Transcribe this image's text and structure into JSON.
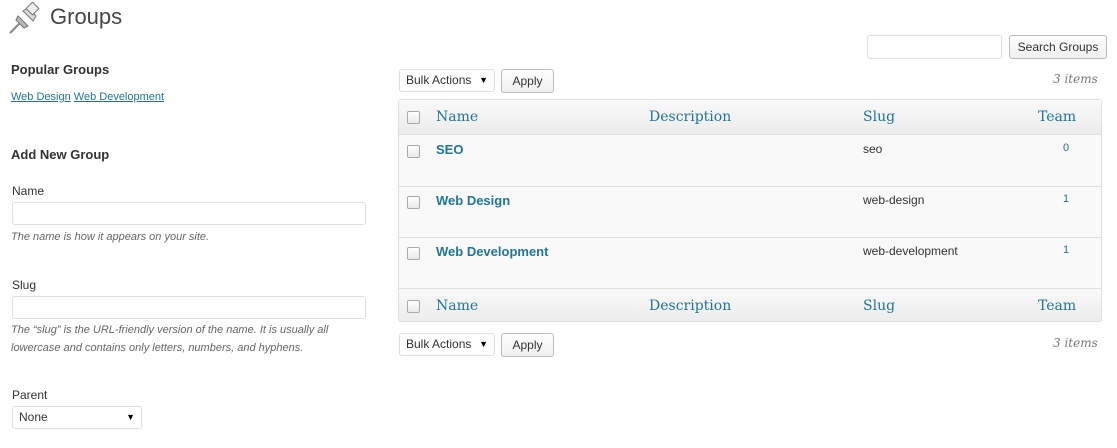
{
  "header": {
    "title": "Groups",
    "icon": "pushpin-icon"
  },
  "popular": {
    "title": "Popular Groups",
    "links": [
      "Web Design",
      "Web Development"
    ]
  },
  "add_group": {
    "title": "Add New Group",
    "name_label": "Name",
    "name_value": "",
    "name_hint": "The name is how it appears on your site.",
    "slug_label": "Slug",
    "slug_value": "",
    "slug_hint": "The “slug” is the URL-friendly version of the name. It is usually all lowercase and contains only letters, numbers, and hyphens.",
    "parent_label": "Parent",
    "parent_value": "None"
  },
  "search": {
    "value": "",
    "button": "Search Groups"
  },
  "bulk_top": {
    "select": "Bulk Actions",
    "apply": "Apply",
    "count": "3 items"
  },
  "bulk_bottom": {
    "select": "Bulk Actions",
    "apply": "Apply",
    "count": "3 items"
  },
  "table": {
    "columns": [
      "Name",
      "Description",
      "Slug",
      "Team"
    ],
    "rows": [
      {
        "name": "SEO",
        "description": "",
        "slug": "seo",
        "team": "0"
      },
      {
        "name": "Web Design",
        "description": "",
        "slug": "web-design",
        "team": "1"
      },
      {
        "name": "Web Development",
        "description": "",
        "slug": "web-development",
        "team": "1"
      }
    ]
  },
  "colors": {
    "link": "#21759b",
    "border": "#dfdfdf",
    "table_bg": "#f9f9f9"
  }
}
